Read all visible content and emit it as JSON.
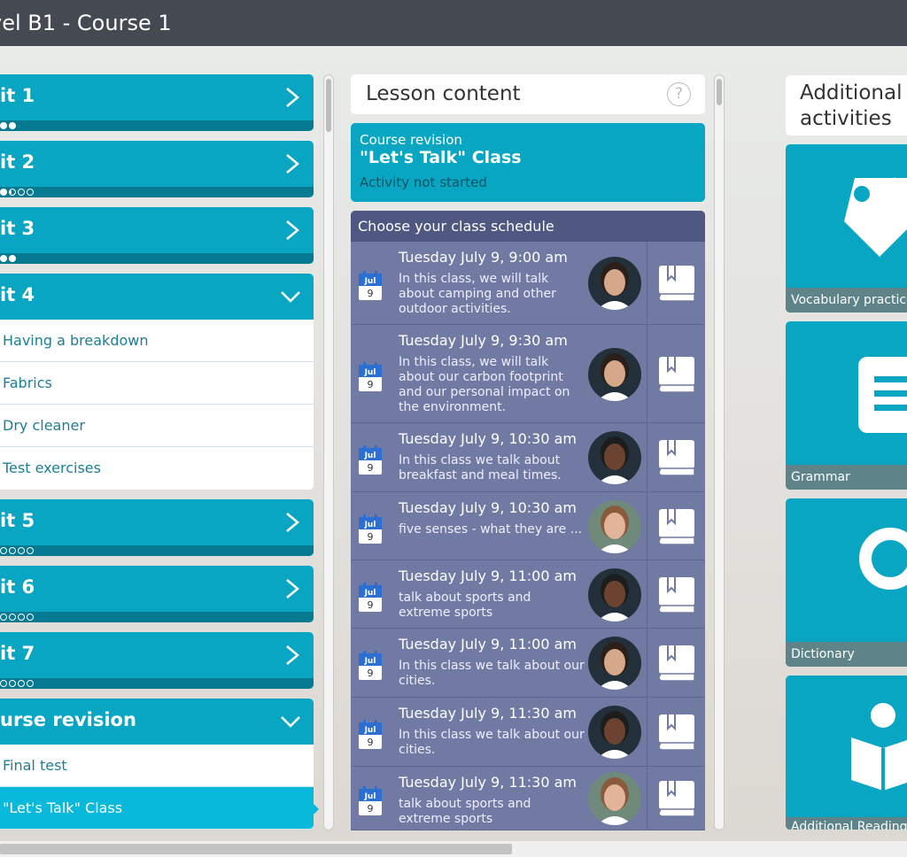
{
  "header": {
    "title": "vel B1 - Course 1"
  },
  "units": [
    {
      "title": "it 1",
      "progress": [
        "full",
        "full"
      ]
    },
    {
      "title": "it 2",
      "progress": [
        "full",
        "half",
        "empty",
        "empty"
      ]
    },
    {
      "title": "it 3",
      "progress": [
        "full",
        "full"
      ]
    },
    {
      "title": "it 4",
      "open": true,
      "lessons": [
        "Having a breakdown",
        "Fabrics",
        "Dry cleaner",
        "Test exercises"
      ]
    },
    {
      "title": "it 5",
      "progress": [
        "empty",
        "empty",
        "empty",
        "empty"
      ]
    },
    {
      "title": "it 6",
      "progress": [
        "empty",
        "empty",
        "empty",
        "empty"
      ]
    },
    {
      "title": "it 7",
      "progress": [
        "empty",
        "empty",
        "empty",
        "empty"
      ]
    },
    {
      "title": "urse revision",
      "open": true,
      "lessons": [
        "Final test",
        "\"Let's Talk\" Class"
      ]
    }
  ],
  "lesson_content": {
    "heading": "Lesson content",
    "help": "?",
    "card": {
      "kicker": "Course revision",
      "title": "\"Let's Talk\" Class",
      "status": "Activity not started"
    },
    "schedule_heading": "Choose your class schedule",
    "calendar": {
      "month": "Jul",
      "day": "9"
    },
    "classes": [
      {
        "time": "Tuesday July 9, 9:00 am",
        "desc": "In this class, we will talk about camping and other outdoor activities.",
        "teacher": "woman-dark"
      },
      {
        "time": "Tuesday July 9, 9:30 am",
        "desc": "In this class, we will talk about our carbon footprint and our personal impact on the environment.",
        "teacher": "woman-dark"
      },
      {
        "time": "Tuesday July 9, 10:30 am",
        "desc": "In this class we talk about breakfast and meal times.",
        "teacher": "man-glasses"
      },
      {
        "time": "Tuesday July 9, 10:30 am",
        "desc": "five senses - what they are ...",
        "teacher": "woman-light"
      },
      {
        "time": "Tuesday July 9, 11:00 am",
        "desc": "talk about sports and extreme sports",
        "teacher": "man-glasses"
      },
      {
        "time": "Tuesday July 9, 11:00 am",
        "desc": "In this class we talk about our cities.",
        "teacher": "woman-dark"
      },
      {
        "time": "Tuesday July 9, 11:30 am",
        "desc": "In this class we talk about our cities.",
        "teacher": "man-glasses"
      },
      {
        "time": "Tuesday July 9, 11:30 am",
        "desc": "talk about sports and extreme sports",
        "teacher": "woman-light"
      }
    ]
  },
  "additional": {
    "heading": "Additional activities",
    "tiles": [
      {
        "label": "Vocabulary practice",
        "icon": "tag-icon"
      },
      {
        "label": "Grammar",
        "icon": "grammar-icon"
      },
      {
        "label": "Dictionary",
        "icon": "magnifier-icon"
      },
      {
        "label": "Additional Reading",
        "icon": "reading-icon"
      }
    ]
  },
  "colors": {
    "accent": "#09a6c3",
    "schedule": "#717aa2",
    "topbar": "#454a52"
  }
}
